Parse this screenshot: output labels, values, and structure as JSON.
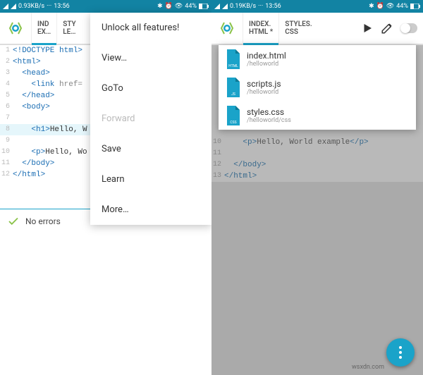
{
  "status": {
    "speed_left": "0.93KB/s",
    "speed_right": "0.19KB/s",
    "time": "13:56",
    "battery": "44%"
  },
  "left_tabs": {
    "t1a": "IND",
    "t1b": "EX…",
    "t2a": "STY",
    "t2b": "LE…"
  },
  "right_tabs": {
    "t1a": "INDEX.",
    "t1b": "HTML *",
    "t2a": "STYLES.",
    "t2b": "CSS"
  },
  "menu": {
    "unlock": "Unlock all features!",
    "view": "View…",
    "goto": "GoTo",
    "forward": "Forward",
    "save": "Save",
    "learn": "Learn",
    "more": "More…"
  },
  "files": {
    "f1": {
      "name": "index.html",
      "path": "/helloworld",
      "badge": "HTML",
      "color": "#1aa3c9"
    },
    "f2": {
      "name": "scripts.js",
      "path": "/helloworld",
      "badge": "JS",
      "color": "#1aa3c9"
    },
    "f3": {
      "name": "styles.css",
      "path": "/helloworld/css",
      "badge": "CSS",
      "color": "#1aa3c9"
    }
  },
  "code_left": {
    "l1": "<!DOCTYPE html>",
    "l2": "<html>",
    "l3": "  <head>",
    "l4_a": "    <link ",
    "l4_b": "href=",
    "l5": "  </head>",
    "l6": "  <body>",
    "l8_a": "    <h1>",
    "l8_b": "Hello, W",
    "l10_a": "    <p>",
    "l10_b": "Hello, Wo",
    "l11": "  </body>",
    "l12": "</html>"
  },
  "code_right": {
    "l10_a": "    <p>",
    "l10_b": "Hello, World example",
    "l10_c": "</p>",
    "l12": "  </body>",
    "l13": "</html>"
  },
  "footer": {
    "no_errors": "No errors"
  },
  "watermark": "wsxdn.com"
}
